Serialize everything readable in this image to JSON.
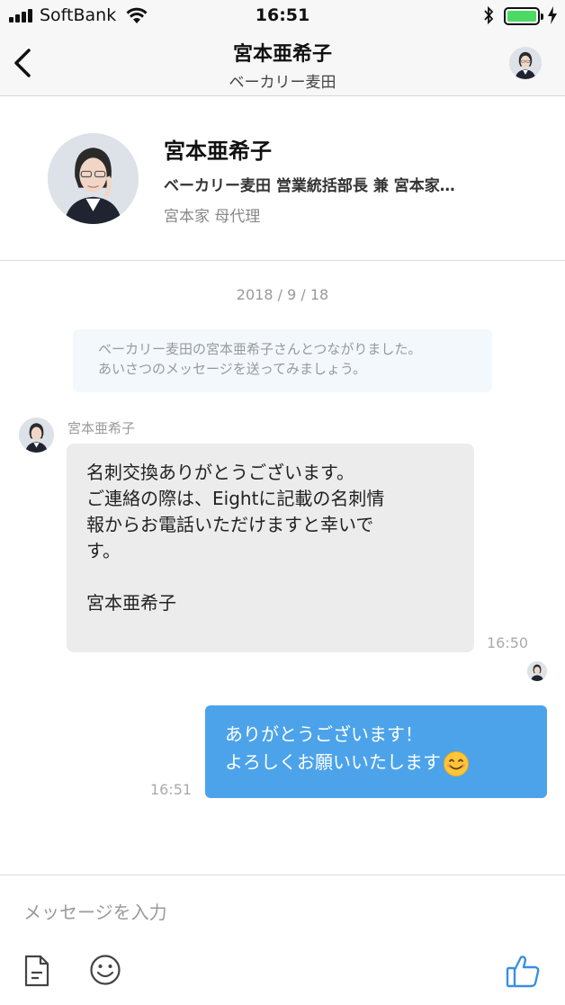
{
  "status_bar": {
    "carrier": "SoftBank",
    "time": "16:51",
    "battery_level": 1.0
  },
  "header": {
    "back_icon": "chevron-left-icon",
    "title": "宮本亜希子",
    "subtitle": "ベーカリー麦田"
  },
  "profile": {
    "name": "宮本亜希子",
    "company_title": "ベーカリー麦田 営業統括部長 兼 宮本家…",
    "role": "宮本家 母代理"
  },
  "chat": {
    "date": "2018 / 9 / 18",
    "system_message": [
      "ベーカリー麦田の宮本亜希子さんとつながりました。",
      "あいさつのメッセージを送ってみましょう。"
    ],
    "messages": [
      {
        "direction": "incoming",
        "sender": "宮本亜希子",
        "lines": [
          "名刺交換ありがとうございます。",
          "ご連絡の際は、Eightに記載の名刺情",
          "報からお電話いただけますと幸いで",
          "す。",
          "",
          "宮本亜希子"
        ],
        "time": "16:50"
      },
      {
        "direction": "outgoing",
        "lines": [
          "ありがとうございます！",
          "よろしくお願いいたします"
        ],
        "emoji": "smiling-face-emoji",
        "time": "16:51",
        "bubble_color": "#4ca3ea"
      }
    ]
  },
  "composer": {
    "placeholder": "メッセージを入力",
    "icons": [
      "document-icon",
      "smiley-icon",
      "thumbs-up-icon"
    ],
    "accent_color": "#3b8fe0"
  }
}
